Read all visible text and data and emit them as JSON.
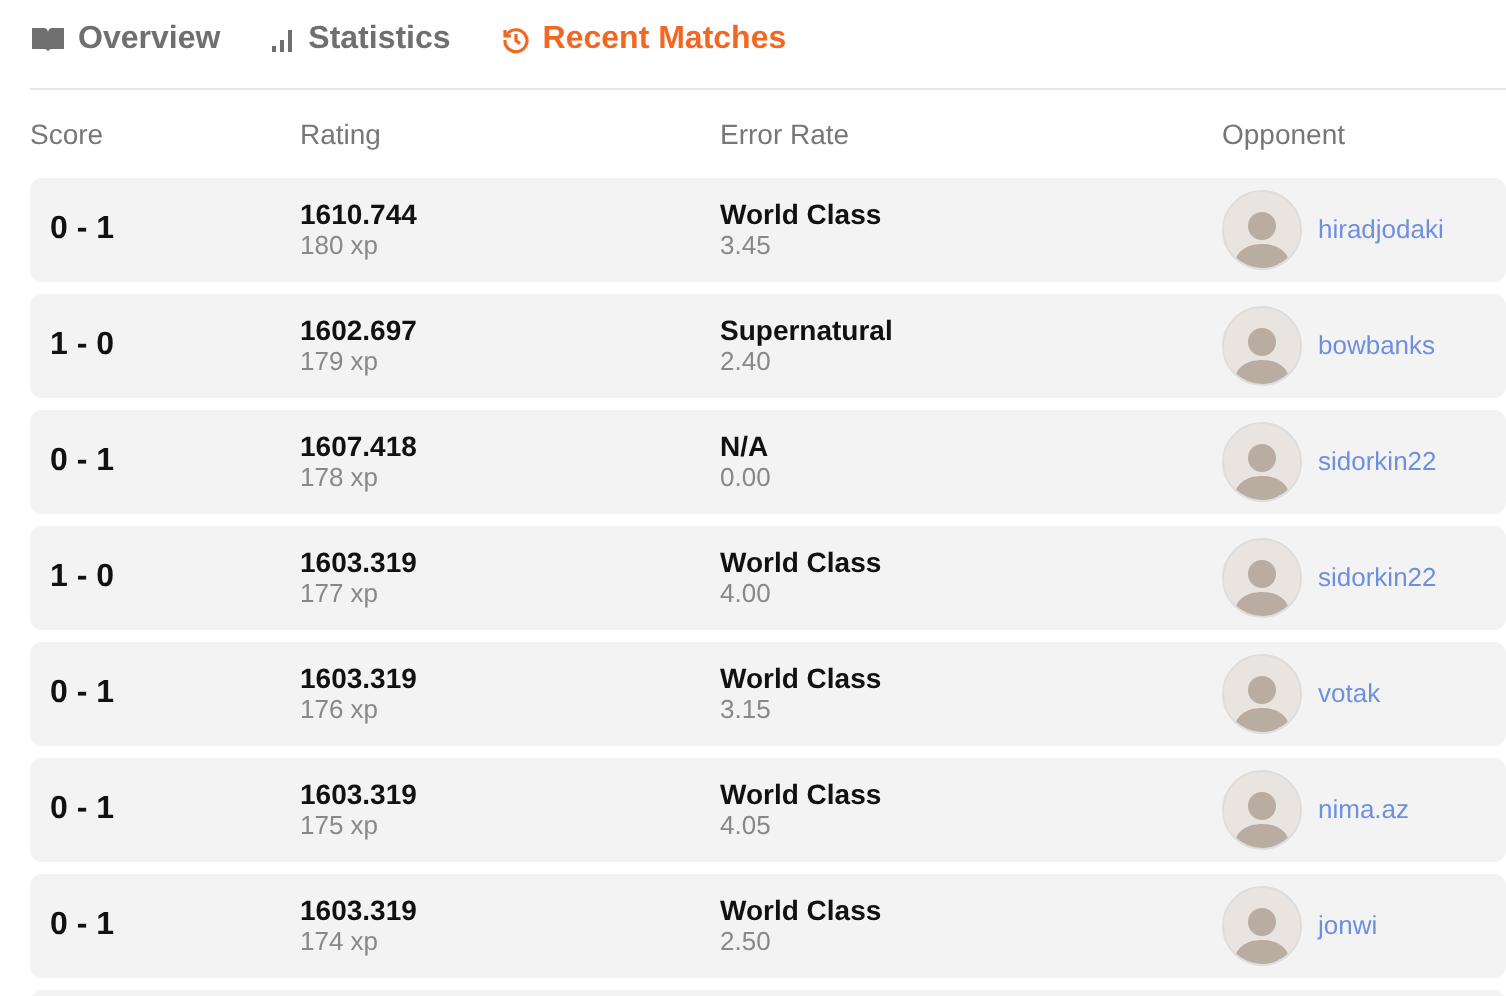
{
  "tabs": [
    {
      "label": "Overview",
      "kind": "book",
      "selected": false
    },
    {
      "label": "Statistics",
      "kind": "chart",
      "selected": false
    },
    {
      "label": "Recent Matches",
      "kind": "history",
      "selected": true
    }
  ],
  "table": {
    "columns": [
      "Score",
      "Rating",
      "Error Rate",
      "Opponent"
    ],
    "rows": [
      {
        "score": "0 - 1",
        "rating": "1610.744",
        "xp": "180 xp",
        "error_label": "World Class",
        "error_rate": "3.45",
        "opponent": "hiradjodaki"
      },
      {
        "score": "1 - 0",
        "rating": "1602.697",
        "xp": "179 xp",
        "error_label": "Supernatural",
        "error_rate": "2.40",
        "opponent": "bowbanks"
      },
      {
        "score": "0 - 1",
        "rating": "1607.418",
        "xp": "178 xp",
        "error_label": "N/A",
        "error_rate": "0.00",
        "opponent": "sidorkin22"
      },
      {
        "score": "1 - 0",
        "rating": "1603.319",
        "xp": "177 xp",
        "error_label": "World Class",
        "error_rate": "4.00",
        "opponent": "sidorkin22"
      },
      {
        "score": "0 - 1",
        "rating": "1603.319",
        "xp": "176 xp",
        "error_label": "World Class",
        "error_rate": "3.15",
        "opponent": "votak"
      },
      {
        "score": "0 - 1",
        "rating": "1603.319",
        "xp": "175 xp",
        "error_label": "World Class",
        "error_rate": "4.05",
        "opponent": "nima.az"
      },
      {
        "score": "0 - 1",
        "rating": "1603.319",
        "xp": "174 xp",
        "error_label": "World Class",
        "error_rate": "2.50",
        "opponent": "jonwi"
      }
    ]
  }
}
